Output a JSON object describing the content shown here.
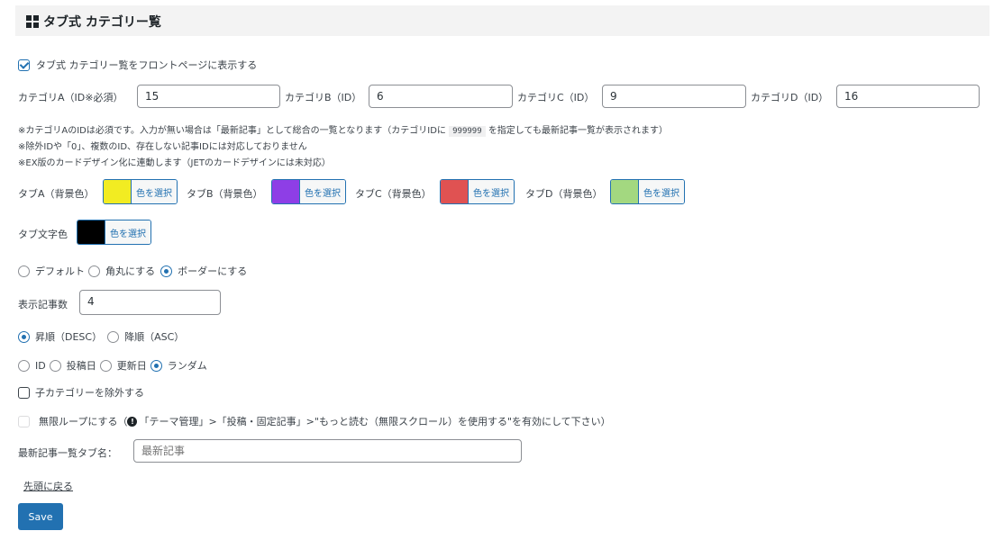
{
  "header": {
    "title": "タブ式 カテゴリー覧"
  },
  "show_front": {
    "label": "タブ式 カテゴリー覧をフロントページに表示する",
    "checked": true
  },
  "categories": [
    {
      "label": "カテゴリA（ID※必須）",
      "value": "15"
    },
    {
      "label": "カテゴリB（ID）",
      "value": "6"
    },
    {
      "label": "カテゴリC（ID）",
      "value": "9"
    },
    {
      "label": "カテゴリD（ID）",
      "value": "16"
    }
  ],
  "notes": {
    "line1_pre": "※カテゴリAのIDは必須です。入力が無い場合は「最新記事」として総合の一覧となります（カテゴリIDに",
    "line1_code": "999999",
    "line1_post": "を指定しても最新記事一覧が表示されます）",
    "line2": "※除外IDや「0」、複数のID、存在しない記事IDには対応しておりません",
    "line3": "※EX版のカードデザイン化に連動します（JETのカードデザインには未対応）"
  },
  "tab_colors": [
    {
      "label": "タブA（背景色）",
      "color": "#f2ec22",
      "button": "色を選択"
    },
    {
      "label": "タブB（背景色）",
      "color": "#8e3ee6",
      "button": "色を選択"
    },
    {
      "label": "タブC（背景色）",
      "color": "#e05252",
      "button": "色を選択"
    },
    {
      "label": "タブD（背景色）",
      "color": "#a3d880",
      "button": "色を選択"
    }
  ],
  "text_color": {
    "label": "タブ文字色",
    "color": "#000000",
    "button": "色を選択"
  },
  "style_options": [
    {
      "label": "デフォルト",
      "checked": false
    },
    {
      "label": "角丸にする",
      "checked": false
    },
    {
      "label": "ボーダーにする",
      "checked": true
    }
  ],
  "count": {
    "label": "表示記事数",
    "value": "4"
  },
  "order_options": [
    {
      "label": "昇順（DESC）",
      "checked": true
    },
    {
      "label": "降順（ASC）",
      "checked": false
    }
  ],
  "sort_options": [
    {
      "label": "ID",
      "checked": false
    },
    {
      "label": "投稿日",
      "checked": false
    },
    {
      "label": "更新日",
      "checked": false
    },
    {
      "label": "ランダム",
      "checked": true
    }
  ],
  "exclude_child": {
    "label": "子カテゴリーを除外する",
    "checked": false
  },
  "infinite_loop": {
    "label": "無限ループにする（",
    "note": "「テーマ管理」>「投稿・固定記事」>\"もっと読む（無限スクロール）を使用する\"を有効にして下さい）"
  },
  "latest_tab": {
    "label": "最新記事一覧タブ名：",
    "placeholder": "最新記事"
  },
  "back_to_top": "先頭に戻る",
  "save": "Save"
}
